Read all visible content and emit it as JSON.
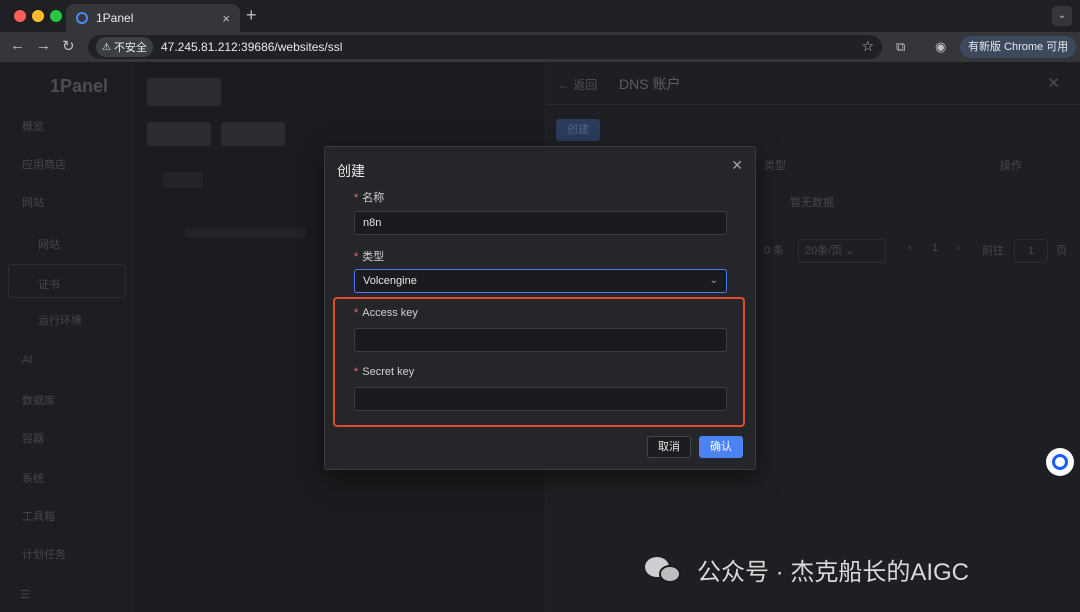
{
  "browser": {
    "tab_title": "1Panel",
    "tab_close": "×",
    "newtab": "+",
    "insecure_label": "不安全",
    "url": "47.245.81.212:39686/websites/ssl",
    "update_label": "有新版 Chrome 可用"
  },
  "sidebar": {
    "logo": "1Panel",
    "items": [
      "概览",
      "应用商店",
      "网站",
      "网站",
      "证书",
      "运行环境",
      "AI",
      "数据库",
      "容器",
      "系统",
      "工具箱",
      "计划任务"
    ]
  },
  "drawer": {
    "back_label": "返回",
    "title": "DNS 账户",
    "create_label": "创建",
    "col_type": "类型",
    "col_action": "操作",
    "empty": "暂无数据",
    "total": "0 条",
    "page_size": "20条/页",
    "page_num": "1",
    "goto_label": "前往",
    "goto_value": "1",
    "page_unit": "页"
  },
  "modal": {
    "title": "创建",
    "name_label": "名称",
    "name_value": "n8n",
    "type_label": "类型",
    "type_value": "Volcengine",
    "access_label": "Access key",
    "access_value": "",
    "secret_label": "Secret key",
    "secret_value": "",
    "cancel_label": "取消",
    "confirm_label": "确认",
    "highlight_color": "#e04a2f",
    "primary_color": "#4a83f6"
  },
  "watermark": {
    "text": "公众号 · 杰克船长的AIGC"
  }
}
